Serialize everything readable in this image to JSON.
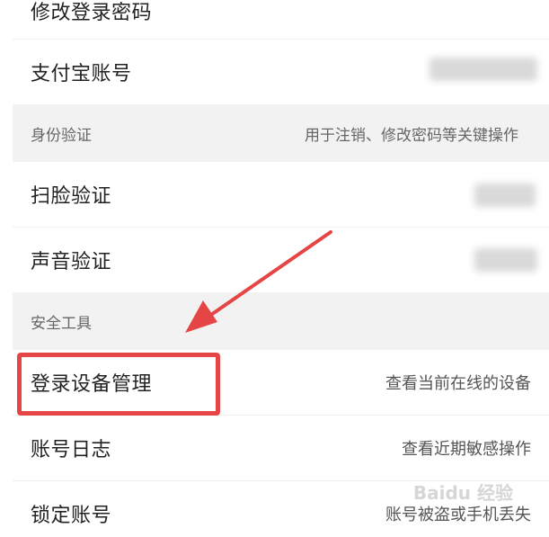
{
  "rows": {
    "change_password": {
      "label": "修改登录密码"
    },
    "alipay_account": {
      "label": "支付宝账号"
    },
    "face_verify": {
      "label": "扫脸验证"
    },
    "voice_verify": {
      "label": "声音验证"
    },
    "device_manage": {
      "label": "登录设备管理",
      "value": "查看当前在线的设备"
    },
    "account_log": {
      "label": "账号日志",
      "value": "查看近期敏感操作"
    },
    "lock_account": {
      "label": "锁定账号",
      "value": "账号被盗或手机丢失"
    }
  },
  "sections": {
    "identity": {
      "title": "身份验证",
      "hint": "用于注销、修改密码等关键操作"
    },
    "security_tools": {
      "title": "安全工具"
    }
  },
  "annotation": {
    "highlight_color": "#e64545",
    "arrow_color": "#e64545"
  },
  "watermark": {
    "text": "Baidu 经验"
  }
}
